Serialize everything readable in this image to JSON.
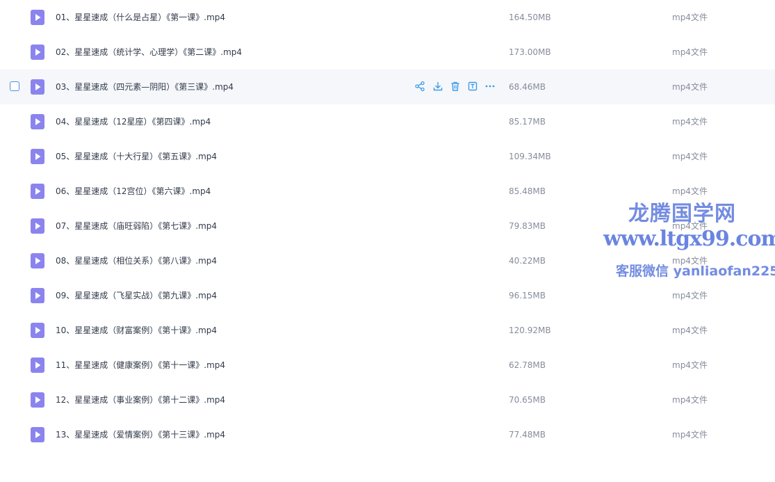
{
  "files": [
    {
      "name": "01、星星速成（什么是占星）《第一课》.mp4",
      "size": "164.50MB",
      "type": "mp4文件"
    },
    {
      "name": "02、星星速成（统计学、心理学）《第二课》.mp4",
      "size": "173.00MB",
      "type": "mp4文件"
    },
    {
      "name": "03、星星速成（四元素—阴阳）《第三课》.mp4",
      "size": "68.46MB",
      "type": "mp4文件"
    },
    {
      "name": "04、星星速成（12星座）《第四课》.mp4",
      "size": "85.17MB",
      "type": "mp4文件"
    },
    {
      "name": "05、星星速成（十大行星）《第五课》.mp4",
      "size": "109.34MB",
      "type": "mp4文件"
    },
    {
      "name": "06、星星速成（12宫位）《第六课》.mp4",
      "size": "85.48MB",
      "type": "mp4文件"
    },
    {
      "name": "07、星星速成（庙旺弱陷）《第七课》.mp4",
      "size": "79.83MB",
      "type": "mp4文件"
    },
    {
      "name": "08、星星速成（相位关系）《第八课》.mp4",
      "size": "40.22MB",
      "type": "mp4文件"
    },
    {
      "name": "09、星星速成（飞星实战）《第九课》.mp4",
      "size": "96.15MB",
      "type": "mp4文件"
    },
    {
      "name": "10、星星速成（财富案例）《第十课》.mp4",
      "size": "120.92MB",
      "type": "mp4文件"
    },
    {
      "name": "11、星星速成（健康案例）《第十一课》.mp4",
      "size": "62.78MB",
      "type": "mp4文件"
    },
    {
      "name": "12、星星速成（事业案例）《第十二课》.mp4",
      "size": "70.65MB",
      "type": "mp4文件"
    },
    {
      "name": "13、星星速成（爱情案例）《第十三课》.mp4",
      "size": "77.48MB",
      "type": "mp4文件"
    }
  ],
  "hovered_row_index": 2,
  "row_actions": [
    "share-icon",
    "download-icon",
    "delete-icon",
    "rename-icon",
    "more-icon"
  ],
  "watermark": {
    "title": "龙腾国学网",
    "url": "www.ltgx99.com",
    "contact": "客服微信 yanliaofan225"
  },
  "colors": {
    "accent": "#3d9be9",
    "icon_purple": "#8b84ee",
    "hover_bg": "#f5f7fb",
    "watermark": "#5a78dc"
  }
}
